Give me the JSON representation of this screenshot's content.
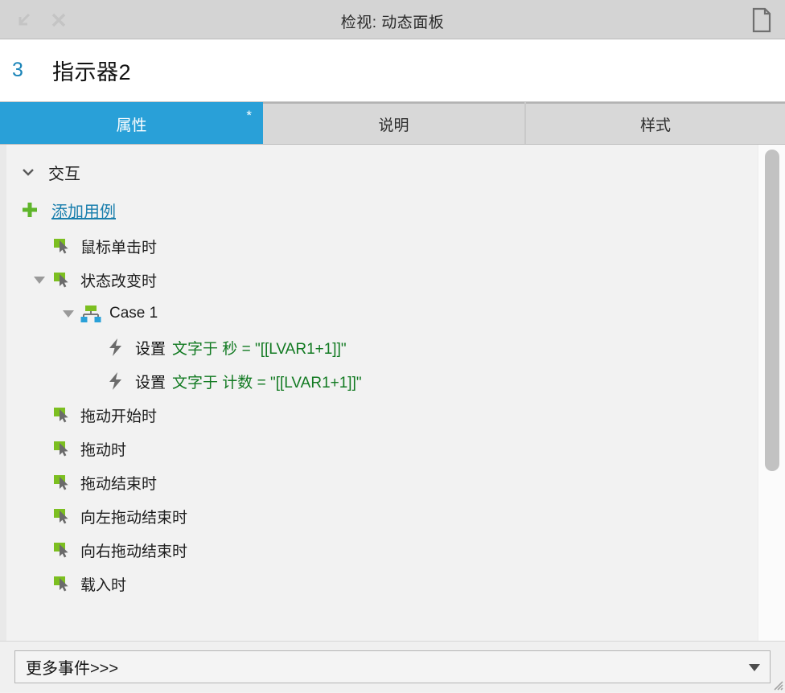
{
  "titlebar": {
    "title": "检视: 动态面板",
    "collapse_icon": "collapse-arrow-icon",
    "close_icon": "close-icon",
    "doc_icon": "document-icon"
  },
  "object_header": {
    "index": "3",
    "name": "指示器2"
  },
  "tabs": [
    {
      "label": "属性",
      "active": true,
      "modified_marker": "*"
    },
    {
      "label": "说明",
      "active": false
    },
    {
      "label": "样式",
      "active": false
    }
  ],
  "tree": {
    "section": {
      "label": "交互",
      "expanded": true
    },
    "add_case": {
      "label": "添加用例"
    },
    "events": [
      {
        "label": "鼠标单击时",
        "expanded": false,
        "has_twisty": false
      },
      {
        "label": "状态改变时",
        "expanded": true,
        "has_twisty": true
      },
      {
        "label": "拖动开始时",
        "expanded": false,
        "has_twisty": false
      },
      {
        "label": "拖动时",
        "expanded": false,
        "has_twisty": false
      },
      {
        "label": "拖动结束时",
        "expanded": false,
        "has_twisty": false
      },
      {
        "label": "向左拖动结束时",
        "expanded": false,
        "has_twisty": false
      },
      {
        "label": "向右拖动结束时",
        "expanded": false,
        "has_twisty": false
      },
      {
        "label": "载入时",
        "expanded": false,
        "has_twisty": false
      }
    ],
    "case": {
      "label": "Case 1",
      "expanded": true
    },
    "actions": [
      {
        "verb": "设置",
        "detail": "文字于 秒 = \"[[LVAR1+1]]\""
      },
      {
        "verb": "设置",
        "detail": "文字于 计数 = \"[[LVAR1+1]]\""
      }
    ]
  },
  "footer": {
    "more_events_label": "更多事件>>>"
  },
  "colors": {
    "accent_blue": "#29a0d8",
    "link_blue": "#1a7fad",
    "index_blue": "#1a84b8",
    "action_green": "#127a22",
    "icon_green": "#7cbf20",
    "icon_blue": "#29a0d8",
    "icon_gray": "#666666"
  }
}
